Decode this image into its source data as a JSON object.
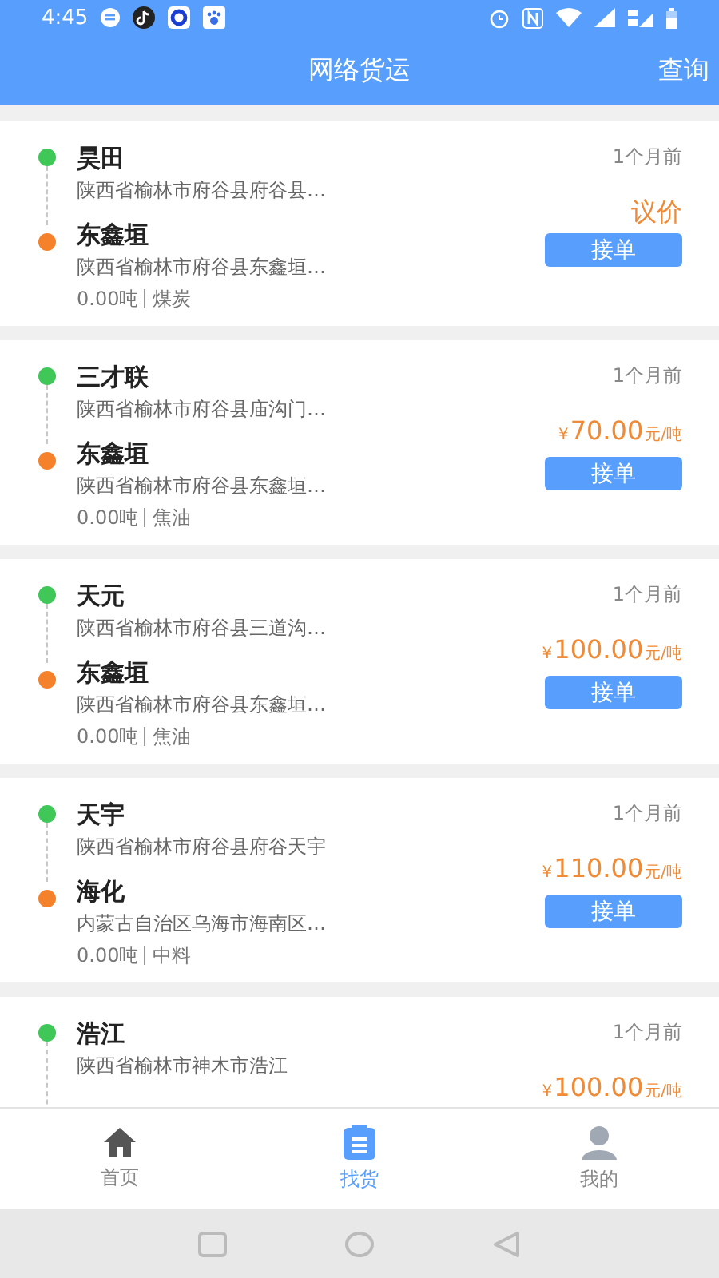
{
  "status_bar": {
    "time": "4:45"
  },
  "header": {
    "title": "网络货运",
    "action": "查询"
  },
  "orders": [
    {
      "origin": {
        "name": "昊田",
        "address": "陕西省榆林市府谷县府谷县…"
      },
      "destination": {
        "name": "东鑫垣",
        "address": "陕西省榆林市府谷县东鑫垣…"
      },
      "weight": "0.00吨",
      "goods": "煤炭",
      "time": "1个月前",
      "price": {
        "kind": "negotiable",
        "text": "议价"
      },
      "button": "接单"
    },
    {
      "origin": {
        "name": "三才联",
        "address": "陕西省榆林市府谷县庙沟门…"
      },
      "destination": {
        "name": "东鑫垣",
        "address": "陕西省榆林市府谷县东鑫垣…"
      },
      "weight": "0.00吨",
      "goods": "焦油",
      "time": "1个月前",
      "price": {
        "kind": "fixed",
        "currency": "¥",
        "amount": "70.00",
        "unit": "元/吨"
      },
      "button": "接单"
    },
    {
      "origin": {
        "name": "天元",
        "address": "陕西省榆林市府谷县三道沟…"
      },
      "destination": {
        "name": "东鑫垣",
        "address": "陕西省榆林市府谷县东鑫垣…"
      },
      "weight": "0.00吨",
      "goods": "焦油",
      "time": "1个月前",
      "price": {
        "kind": "fixed",
        "currency": "¥",
        "amount": "100.00",
        "unit": "元/吨"
      },
      "button": "接单"
    },
    {
      "origin": {
        "name": "天宇",
        "address": "陕西省榆林市府谷县府谷天宇"
      },
      "destination": {
        "name": "海化",
        "address": "内蒙古自治区乌海市海南区…"
      },
      "weight": "0.00吨",
      "goods": "中料",
      "time": "1个月前",
      "price": {
        "kind": "fixed",
        "currency": "¥",
        "amount": "110.00",
        "unit": "元/吨"
      },
      "button": "接单"
    },
    {
      "origin": {
        "name": "浩江",
        "address": "陕西省榆林市神木市浩江"
      },
      "time": "1个月前",
      "price": {
        "kind": "fixed",
        "currency": "¥",
        "amount": "100.00",
        "unit": "元/吨"
      }
    }
  ],
  "tab_bar": [
    {
      "kind": "home",
      "label": "首页",
      "selected": false
    },
    {
      "kind": "cargo",
      "label": "找货",
      "selected": true
    },
    {
      "kind": "profile",
      "label": "我的",
      "selected": false
    }
  ]
}
